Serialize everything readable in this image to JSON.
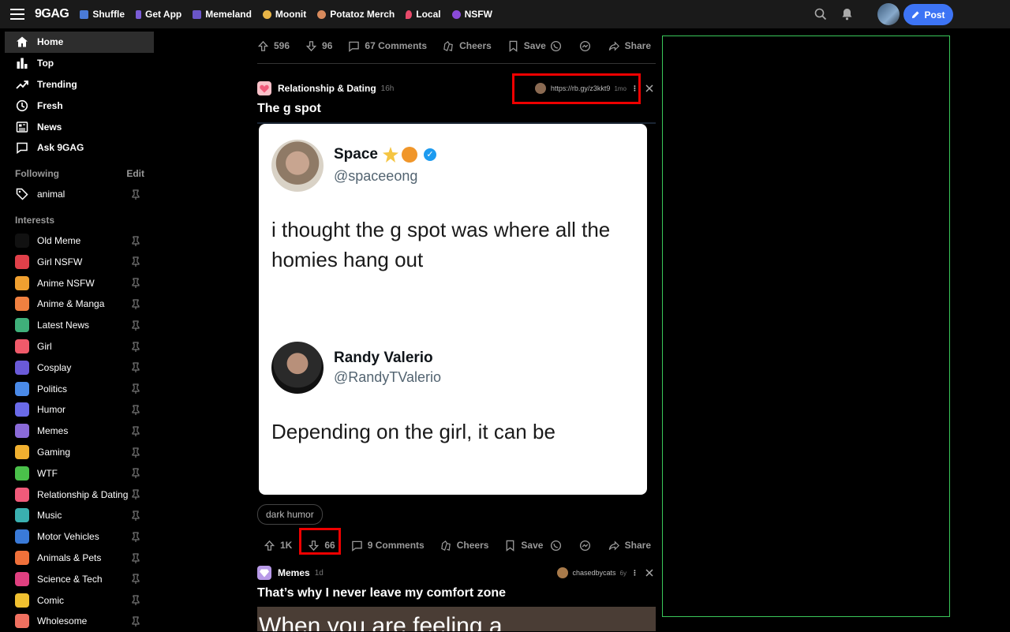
{
  "topbar": {
    "logo": "9GAG",
    "nav": [
      {
        "label": "Shuffle",
        "color": "#4a7bd8"
      },
      {
        "label": "Get App",
        "color": "#7a5cd6"
      },
      {
        "label": "Memeland",
        "color": "#6a55c8"
      },
      {
        "label": "Moonit",
        "color": "#e8b547"
      },
      {
        "label": "Potatoz Merch",
        "color": "#d88a5c"
      },
      {
        "label": "Local",
        "color": "#e84a6a"
      },
      {
        "label": "NSFW",
        "color": "#8a4ad8"
      }
    ],
    "post_label": "Post"
  },
  "sidebar": {
    "main": [
      {
        "label": "Home"
      },
      {
        "label": "Top"
      },
      {
        "label": "Trending"
      },
      {
        "label": "Fresh"
      },
      {
        "label": "News"
      },
      {
        "label": "Ask 9GAG"
      }
    ],
    "following_label": "Following",
    "edit_label": "Edit",
    "following": [
      {
        "label": "animal"
      }
    ],
    "interests_label": "Interests",
    "interests": [
      {
        "label": "Old Meme",
        "color": "#111111"
      },
      {
        "label": "Girl NSFW",
        "color": "#e0404a"
      },
      {
        "label": "Anime NSFW",
        "color": "#f0a030"
      },
      {
        "label": "Anime & Manga",
        "color": "#f08040"
      },
      {
        "label": "Latest News",
        "color": "#3fb07a"
      },
      {
        "label": "Girl",
        "color": "#f05a6a"
      },
      {
        "label": "Cosplay",
        "color": "#6a5ad8"
      },
      {
        "label": "Politics",
        "color": "#4a8ae8"
      },
      {
        "label": "Humor",
        "color": "#6a6ae8"
      },
      {
        "label": "Memes",
        "color": "#8a6ad8"
      },
      {
        "label": "Gaming",
        "color": "#f0b030"
      },
      {
        "label": "WTF",
        "color": "#4ac04a"
      },
      {
        "label": "Relationship & Dating",
        "color": "#f05a7a"
      },
      {
        "label": "Music",
        "color": "#3ab0b0"
      },
      {
        "label": "Motor Vehicles",
        "color": "#3a7ad8"
      },
      {
        "label": "Animals & Pets",
        "color": "#f0703a"
      },
      {
        "label": "Science & Tech",
        "color": "#e04080"
      },
      {
        "label": "Comic",
        "color": "#f0c030"
      },
      {
        "label": "Wholesome",
        "color": "#f07060"
      }
    ]
  },
  "feed": {
    "top_actions": {
      "up": "596",
      "down": "96",
      "comments": "67 Comments",
      "cheers": "Cheers",
      "save": "Save",
      "share": "Share"
    },
    "post1": {
      "section": "Relationship & Dating",
      "age": "16h",
      "author": "https://rb.gy/z3kkt9",
      "author_age": "1mo",
      "title": "The g spot",
      "tweet1": {
        "name": "Space",
        "handle": "@spaceeong",
        "text": "i thought the g spot was where all the homies hang out"
      },
      "tweet2": {
        "name": "Randy Valerio",
        "handle": "@RandyTValerio",
        "text": "Depending on the girl, it can be"
      },
      "tag": "dark humor",
      "actions": {
        "up": "1K",
        "down": "66",
        "comments": "9 Comments",
        "cheers": "Cheers",
        "save": "Save",
        "share": "Share"
      }
    },
    "post2": {
      "section": "Memes",
      "age": "1d",
      "author": "chasedbycats",
      "author_age": "6y",
      "title": "That’s why I never leave my comfort zone",
      "media_text": "When you are feeling a"
    }
  }
}
